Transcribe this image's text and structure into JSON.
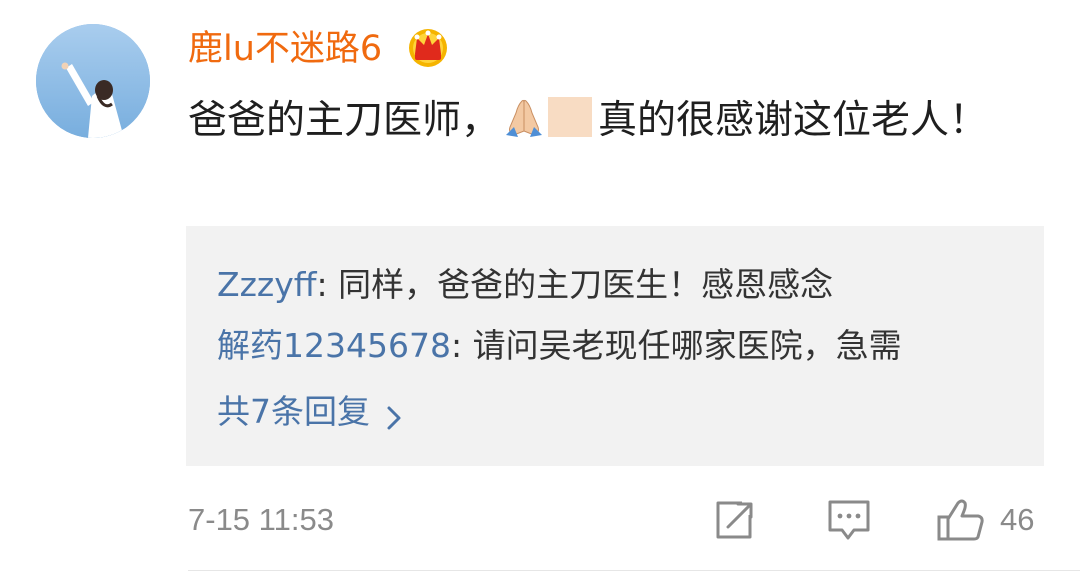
{
  "comment": {
    "username": "鹿lu不迷路6",
    "text_before_emoji": "爸爸的主刀医师，",
    "text_after_emoji": "真的很感谢这位老人！",
    "timestamp": "7-15 11:53",
    "like_count": "46"
  },
  "replies": [
    {
      "user": "Zzzyff",
      "text": ": 同样，爸爸的主刀医生！感恩感念"
    },
    {
      "user": "解药12345678",
      "text": ": 请问吴老现任哪家医院，急需"
    }
  ],
  "more_replies_label": "共7条回复",
  "icons": {
    "badge": "crown-vip-icon",
    "emoji": "folded-hands-icon",
    "share": "share-icon",
    "reply": "comment-icon",
    "like": "thumbs-up-icon"
  },
  "colors": {
    "username": "#f06a0f",
    "link": "#4a74a8",
    "meta": "#8a8a8a",
    "reply_bg": "#f2f2f2"
  }
}
